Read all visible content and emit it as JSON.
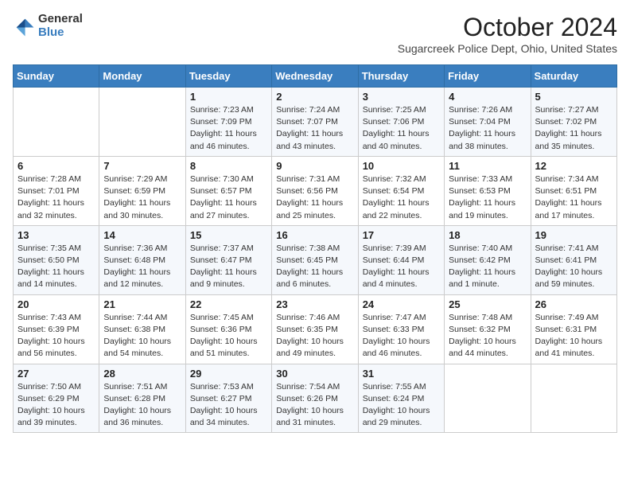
{
  "header": {
    "logo_general": "General",
    "logo_blue": "Blue",
    "title": "October 2024",
    "subtitle": "Sugarcreek Police Dept, Ohio, United States"
  },
  "days_of_week": [
    "Sunday",
    "Monday",
    "Tuesday",
    "Wednesday",
    "Thursday",
    "Friday",
    "Saturday"
  ],
  "weeks": [
    [
      {
        "day": "",
        "sunrise": "",
        "sunset": "",
        "daylight": ""
      },
      {
        "day": "",
        "sunrise": "",
        "sunset": "",
        "daylight": ""
      },
      {
        "day": "1",
        "sunrise": "Sunrise: 7:23 AM",
        "sunset": "Sunset: 7:09 PM",
        "daylight": "Daylight: 11 hours and 46 minutes."
      },
      {
        "day": "2",
        "sunrise": "Sunrise: 7:24 AM",
        "sunset": "Sunset: 7:07 PM",
        "daylight": "Daylight: 11 hours and 43 minutes."
      },
      {
        "day": "3",
        "sunrise": "Sunrise: 7:25 AM",
        "sunset": "Sunset: 7:06 PM",
        "daylight": "Daylight: 11 hours and 40 minutes."
      },
      {
        "day": "4",
        "sunrise": "Sunrise: 7:26 AM",
        "sunset": "Sunset: 7:04 PM",
        "daylight": "Daylight: 11 hours and 38 minutes."
      },
      {
        "day": "5",
        "sunrise": "Sunrise: 7:27 AM",
        "sunset": "Sunset: 7:02 PM",
        "daylight": "Daylight: 11 hours and 35 minutes."
      }
    ],
    [
      {
        "day": "6",
        "sunrise": "Sunrise: 7:28 AM",
        "sunset": "Sunset: 7:01 PM",
        "daylight": "Daylight: 11 hours and 32 minutes."
      },
      {
        "day": "7",
        "sunrise": "Sunrise: 7:29 AM",
        "sunset": "Sunset: 6:59 PM",
        "daylight": "Daylight: 11 hours and 30 minutes."
      },
      {
        "day": "8",
        "sunrise": "Sunrise: 7:30 AM",
        "sunset": "Sunset: 6:57 PM",
        "daylight": "Daylight: 11 hours and 27 minutes."
      },
      {
        "day": "9",
        "sunrise": "Sunrise: 7:31 AM",
        "sunset": "Sunset: 6:56 PM",
        "daylight": "Daylight: 11 hours and 25 minutes."
      },
      {
        "day": "10",
        "sunrise": "Sunrise: 7:32 AM",
        "sunset": "Sunset: 6:54 PM",
        "daylight": "Daylight: 11 hours and 22 minutes."
      },
      {
        "day": "11",
        "sunrise": "Sunrise: 7:33 AM",
        "sunset": "Sunset: 6:53 PM",
        "daylight": "Daylight: 11 hours and 19 minutes."
      },
      {
        "day": "12",
        "sunrise": "Sunrise: 7:34 AM",
        "sunset": "Sunset: 6:51 PM",
        "daylight": "Daylight: 11 hours and 17 minutes."
      }
    ],
    [
      {
        "day": "13",
        "sunrise": "Sunrise: 7:35 AM",
        "sunset": "Sunset: 6:50 PM",
        "daylight": "Daylight: 11 hours and 14 minutes."
      },
      {
        "day": "14",
        "sunrise": "Sunrise: 7:36 AM",
        "sunset": "Sunset: 6:48 PM",
        "daylight": "Daylight: 11 hours and 12 minutes."
      },
      {
        "day": "15",
        "sunrise": "Sunrise: 7:37 AM",
        "sunset": "Sunset: 6:47 PM",
        "daylight": "Daylight: 11 hours and 9 minutes."
      },
      {
        "day": "16",
        "sunrise": "Sunrise: 7:38 AM",
        "sunset": "Sunset: 6:45 PM",
        "daylight": "Daylight: 11 hours and 6 minutes."
      },
      {
        "day": "17",
        "sunrise": "Sunrise: 7:39 AM",
        "sunset": "Sunset: 6:44 PM",
        "daylight": "Daylight: 11 hours and 4 minutes."
      },
      {
        "day": "18",
        "sunrise": "Sunrise: 7:40 AM",
        "sunset": "Sunset: 6:42 PM",
        "daylight": "Daylight: 11 hours and 1 minute."
      },
      {
        "day": "19",
        "sunrise": "Sunrise: 7:41 AM",
        "sunset": "Sunset: 6:41 PM",
        "daylight": "Daylight: 10 hours and 59 minutes."
      }
    ],
    [
      {
        "day": "20",
        "sunrise": "Sunrise: 7:43 AM",
        "sunset": "Sunset: 6:39 PM",
        "daylight": "Daylight: 10 hours and 56 minutes."
      },
      {
        "day": "21",
        "sunrise": "Sunrise: 7:44 AM",
        "sunset": "Sunset: 6:38 PM",
        "daylight": "Daylight: 10 hours and 54 minutes."
      },
      {
        "day": "22",
        "sunrise": "Sunrise: 7:45 AM",
        "sunset": "Sunset: 6:36 PM",
        "daylight": "Daylight: 10 hours and 51 minutes."
      },
      {
        "day": "23",
        "sunrise": "Sunrise: 7:46 AM",
        "sunset": "Sunset: 6:35 PM",
        "daylight": "Daylight: 10 hours and 49 minutes."
      },
      {
        "day": "24",
        "sunrise": "Sunrise: 7:47 AM",
        "sunset": "Sunset: 6:33 PM",
        "daylight": "Daylight: 10 hours and 46 minutes."
      },
      {
        "day": "25",
        "sunrise": "Sunrise: 7:48 AM",
        "sunset": "Sunset: 6:32 PM",
        "daylight": "Daylight: 10 hours and 44 minutes."
      },
      {
        "day": "26",
        "sunrise": "Sunrise: 7:49 AM",
        "sunset": "Sunset: 6:31 PM",
        "daylight": "Daylight: 10 hours and 41 minutes."
      }
    ],
    [
      {
        "day": "27",
        "sunrise": "Sunrise: 7:50 AM",
        "sunset": "Sunset: 6:29 PM",
        "daylight": "Daylight: 10 hours and 39 minutes."
      },
      {
        "day": "28",
        "sunrise": "Sunrise: 7:51 AM",
        "sunset": "Sunset: 6:28 PM",
        "daylight": "Daylight: 10 hours and 36 minutes."
      },
      {
        "day": "29",
        "sunrise": "Sunrise: 7:53 AM",
        "sunset": "Sunset: 6:27 PM",
        "daylight": "Daylight: 10 hours and 34 minutes."
      },
      {
        "day": "30",
        "sunrise": "Sunrise: 7:54 AM",
        "sunset": "Sunset: 6:26 PM",
        "daylight": "Daylight: 10 hours and 31 minutes."
      },
      {
        "day": "31",
        "sunrise": "Sunrise: 7:55 AM",
        "sunset": "Sunset: 6:24 PM",
        "daylight": "Daylight: 10 hours and 29 minutes."
      },
      {
        "day": "",
        "sunrise": "",
        "sunset": "",
        "daylight": ""
      },
      {
        "day": "",
        "sunrise": "",
        "sunset": "",
        "daylight": ""
      }
    ]
  ]
}
